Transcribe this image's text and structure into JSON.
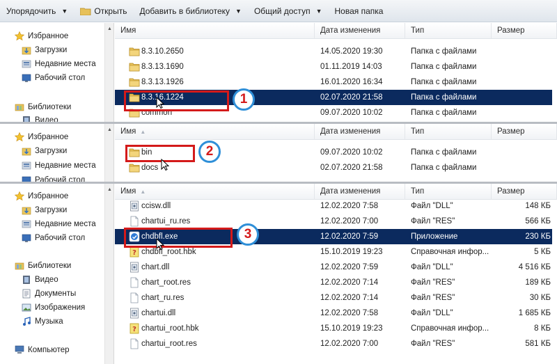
{
  "toolbar": {
    "organize": "Упорядочить",
    "open": "Открыть",
    "add_to_library": "Добавить в библиотеку",
    "share": "Общий доступ",
    "new_folder": "Новая папка"
  },
  "columns": {
    "name": "Имя",
    "date": "Дата изменения",
    "type": "Тип",
    "size": "Размер"
  },
  "nav": {
    "favorites": "Избранное",
    "downloads": "Загрузки",
    "recent": "Недавние места",
    "desktop": "Рабочий стол",
    "libraries": "Библиотеки",
    "video_cut": "Видео",
    "video": "Видео",
    "documents": "Документы",
    "images": "Изображения",
    "music": "Музыка",
    "computer": "Компьютер"
  },
  "panel1": {
    "rows": [
      {
        "name": "8.3.10.2650",
        "date": "14.05.2020 19:30",
        "type": "Папка с файлами",
        "size": ""
      },
      {
        "name": "8.3.13.1690",
        "date": "01.11.2019 14:03",
        "type": "Папка с файлами",
        "size": ""
      },
      {
        "name": "8.3.13.1926",
        "date": "16.01.2020 16:34",
        "type": "Папка с файлами",
        "size": ""
      },
      {
        "name": "8.3.16.1224",
        "date": "02.07.2020 21:58",
        "type": "Папка с файлами",
        "size": ""
      },
      {
        "name": "common",
        "date": "09.07.2020 10:02",
        "type": "Папка с файлами",
        "size": ""
      }
    ]
  },
  "panel2": {
    "rows": [
      {
        "name": "bin",
        "date": "09.07.2020 10:02",
        "type": "Папка с файлами",
        "size": ""
      },
      {
        "name": "docs",
        "date": "02.07.2020 21:58",
        "type": "Папка с файлами",
        "size": ""
      }
    ]
  },
  "panel3": {
    "rows": [
      {
        "name": "ccisw.dll",
        "date": "12.02.2020 7:58",
        "type": "Файл \"DLL\"",
        "size": "148 КБ"
      },
      {
        "name": "chartui_ru.res",
        "date": "12.02.2020 7:00",
        "type": "Файл \"RES\"",
        "size": "566 КБ"
      },
      {
        "name": "chdbfl.exe",
        "date": "12.02.2020 7:59",
        "type": "Приложение",
        "size": "230 КБ"
      },
      {
        "name": "chdbfl_root.hbk",
        "date": "15.10.2019 19:23",
        "type": "Справочная инфор...",
        "size": "5 КБ"
      },
      {
        "name": "chart.dll",
        "date": "12.02.2020 7:59",
        "type": "Файл \"DLL\"",
        "size": "4 516 КБ"
      },
      {
        "name": "chart_root.res",
        "date": "12.02.2020 7:14",
        "type": "Файл \"RES\"",
        "size": "189 КБ"
      },
      {
        "name": "chart_ru.res",
        "date": "12.02.2020 7:14",
        "type": "Файл \"RES\"",
        "size": "30 КБ"
      },
      {
        "name": "chartui.dll",
        "date": "12.02.2020 7:58",
        "type": "Файл \"DLL\"",
        "size": "1 685 КБ"
      },
      {
        "name": "chartui_root.hbk",
        "date": "15.10.2019 19:23",
        "type": "Справочная инфор...",
        "size": "8 КБ"
      },
      {
        "name": "chartui_root.res",
        "date": "12.02.2020 7:00",
        "type": "Файл \"RES\"",
        "size": "581 КБ"
      }
    ]
  },
  "badges": {
    "one": "1",
    "two": "2",
    "three": "3"
  },
  "colors": {
    "selection": "#0b2a5e",
    "highlight_box": "#d41a1a",
    "badge_ring": "#2f8fd8"
  }
}
